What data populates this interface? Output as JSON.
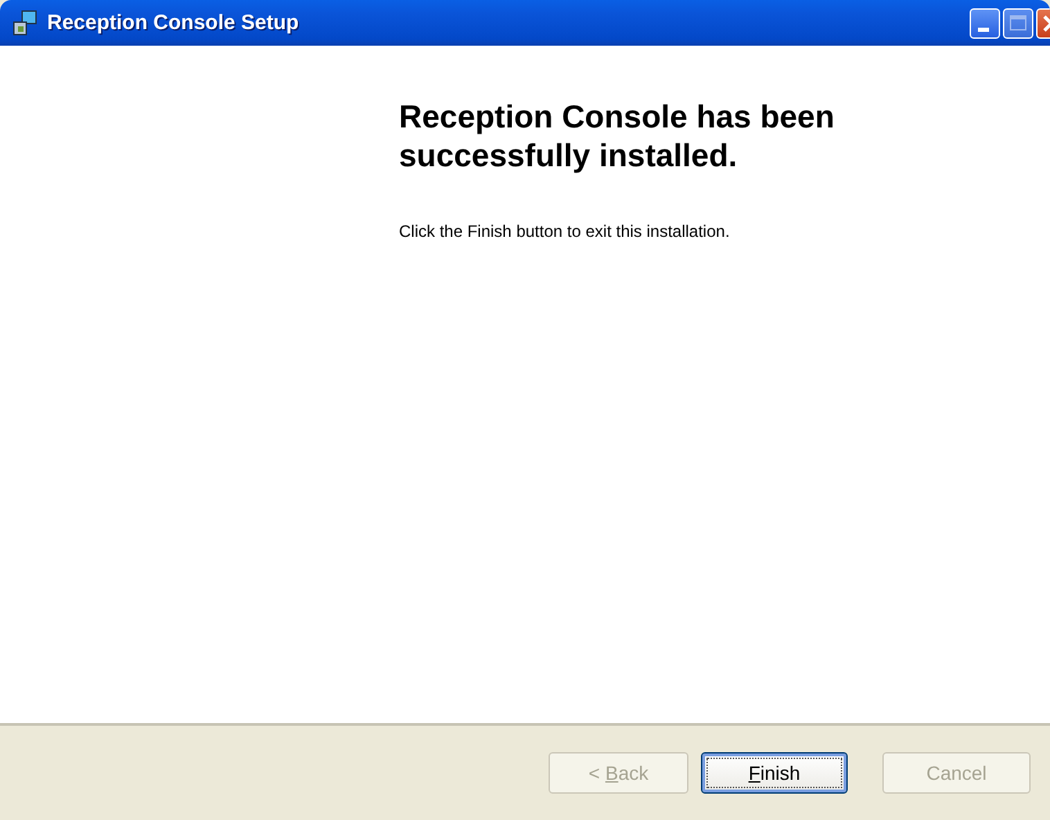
{
  "window": {
    "title": "Reception Console Setup"
  },
  "heading": "Reception Console has been successfully installed.",
  "message": "Click the Finish button to exit this installation.",
  "buttons": [
    {
      "label_before": "< ",
      "mnemonic": "B",
      "label_after": "ack",
      "disabled": true,
      "default": false
    },
    {
      "mnemonic": "F",
      "label_after": "inish",
      "disabled": false,
      "default": true
    },
    {
      "label_before": "Cancel",
      "disabled": true,
      "default": false
    }
  ]
}
